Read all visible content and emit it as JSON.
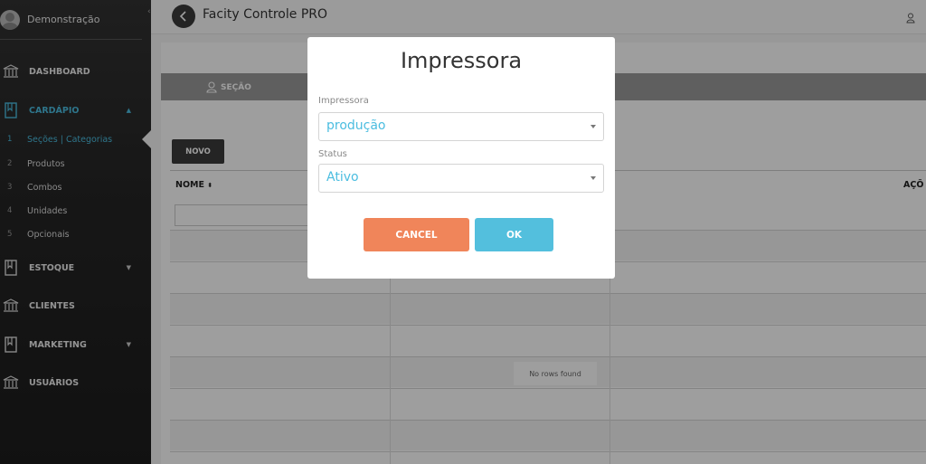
{
  "sidebar": {
    "user_name": "Demonstração",
    "items": [
      {
        "label": "DASHBOARD"
      },
      {
        "label": "CARDÁPIO"
      },
      {
        "label": "ESTOQUE"
      },
      {
        "label": "CLIENTES"
      },
      {
        "label": "MARKETING"
      },
      {
        "label": "USUÁRIOS"
      }
    ],
    "subitems": [
      {
        "num": "1",
        "label": "Seções | Categorias"
      },
      {
        "num": "2",
        "label": "Produtos"
      },
      {
        "num": "3",
        "label": "Combos"
      },
      {
        "num": "4",
        "label": "Unidades"
      },
      {
        "num": "5",
        "label": "Opcionais"
      }
    ]
  },
  "topbar": {
    "title": "Facity Controle PRO"
  },
  "main": {
    "section_tab": "SEÇÃO",
    "novo_label": "NOVO",
    "columns": {
      "nome": "NOME",
      "acoes": "AÇÕ"
    },
    "no_rows": "No rows found"
  },
  "modal": {
    "title": "Impressora",
    "printer_label": "Impressora",
    "printer_value": "produção",
    "status_label": "Status",
    "status_value": "Ativo",
    "cancel_label": "CANCEL",
    "ok_label": "OK"
  },
  "colors": {
    "accent": "#4bbde0",
    "cancel": "#f0855a",
    "ok": "#53bfdd",
    "sidebar": "#2b2b2b"
  }
}
